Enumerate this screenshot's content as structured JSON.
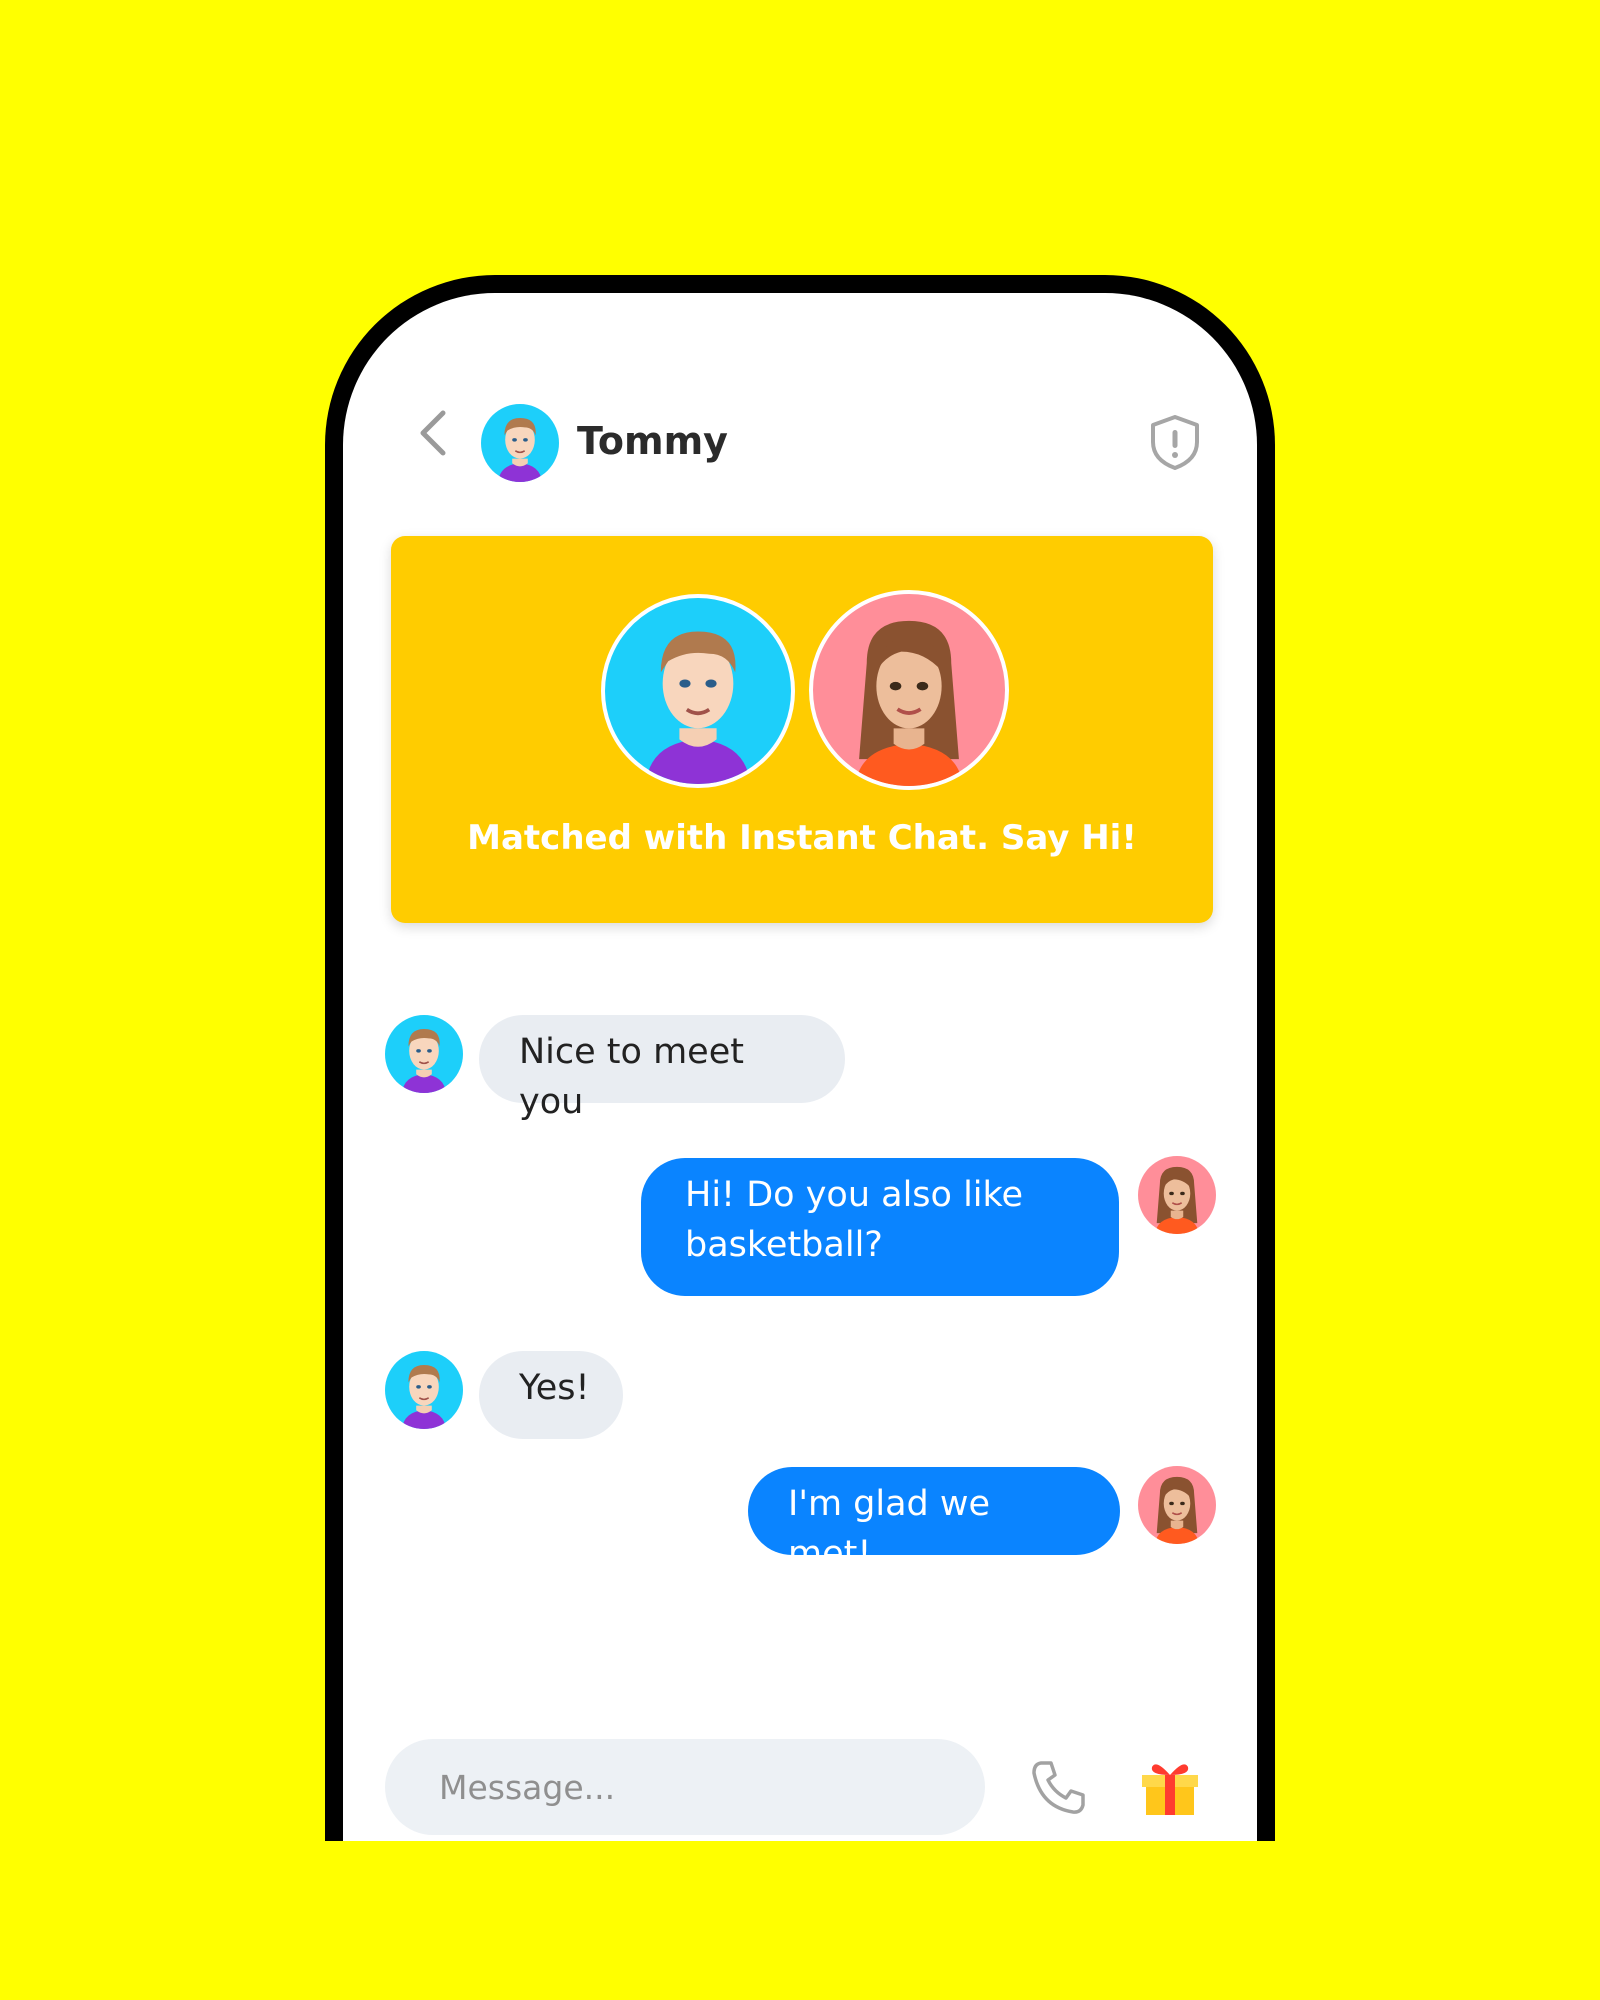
{
  "header": {
    "contact_name": "Tommy",
    "back_icon": "chevron-left-icon",
    "report_icon": "shield-alert-icon"
  },
  "match_card": {
    "text": "Matched with Instant Chat. Say Hi!",
    "background": "#FFCC00"
  },
  "messages": [
    {
      "sender": "Tommy",
      "direction": "incoming",
      "text": "Nice to meet you"
    },
    {
      "sender": "me",
      "direction": "outgoing",
      "text": "Hi! Do you also like basketball?"
    },
    {
      "sender": "Tommy",
      "direction": "incoming",
      "text": "Yes!"
    },
    {
      "sender": "me",
      "direction": "outgoing",
      "text": "I'm glad we met!"
    }
  ],
  "composer": {
    "placeholder": "Message...",
    "call_icon": "phone-icon",
    "gift_icon": "gift-icon"
  },
  "colors": {
    "background": "#FFFF00",
    "outgoing_bubble": "#0A84FF",
    "incoming_bubble": "#E9EDF2",
    "boy_avatar_bg": "#1DCFFA",
    "girl_avatar_bg": "#FF8E99"
  }
}
